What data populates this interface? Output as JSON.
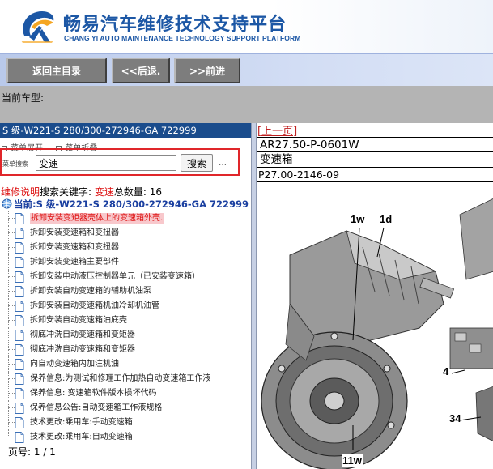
{
  "header": {
    "title_cn": "畅易汽车维修技术支持平台",
    "title_en": "CHANG YI AUTO MAINTENANCE TECHNOLOGY SUPPORT PLATFORM",
    "logo": "cy-logo-icon"
  },
  "nav": {
    "home_label": "返回主目录",
    "back_label": "<<后退.",
    "forward_label": ">>前进"
  },
  "model_row": {
    "label": "当前车型:"
  },
  "left_panel": {
    "model_title": "S 级-W221-S 280/300-272946-GA 722999",
    "expand_label": "菜单展开",
    "collapse_label": "菜单折叠",
    "search_label": "菜单搜索",
    "search_value": "变速",
    "search_button": "搜索",
    "search_more": "…",
    "result": {
      "prefix": "维修说明",
      "keyword_label": "搜索关键字:",
      "keyword": "变速",
      "count_label": "总数量:",
      "count": "16"
    },
    "tree_root": "当前:S 级-W221-S 280/300-272946-GA 722999",
    "items": [
      "拆卸安装变矩器壳体上的变速箱外壳.",
      "拆卸安装变速箱和变扭器",
      "拆卸安装变速箱和变扭器",
      "拆卸安装变速箱主要部件",
      "拆卸安装电动液压控制器单元（已安装变速箱）",
      "拆卸安装自动变速箱的辅助机油泵",
      "拆卸安装自动变速箱机油冷却机油管",
      "拆卸安装自动变速箱油底壳",
      "彻底冲洗自动变速箱和变矩器",
      "彻底冲洗自动变速箱和变矩器",
      "向自动变速箱内加注机油",
      "保养信息:为测试和修理工作加热自动变速箱工作液",
      "保养信息: 变速箱软件版本损坏代码",
      "保养信息公告:自动变速箱工作液规格",
      "技术更改:乘用车:手动变速箱",
      "技术更改:乘用车:自动变速箱"
    ],
    "pager": {
      "label": "页号:",
      "value": "1 / 1"
    }
  },
  "right_panel": {
    "prev_link": "[上一页]",
    "doc_code": "AR27.50-P-0601W",
    "doc_title": "变速箱",
    "fig_code": "P27.00-2146-09",
    "callouts": [
      "1w",
      "1d",
      "4",
      "34",
      "11w"
    ]
  },
  "colors": {
    "brand_blue": "#1c57a5",
    "model_title_bg": "#1a4c8c",
    "highlight_red": "#d11",
    "search_outline": "#e0262a"
  }
}
